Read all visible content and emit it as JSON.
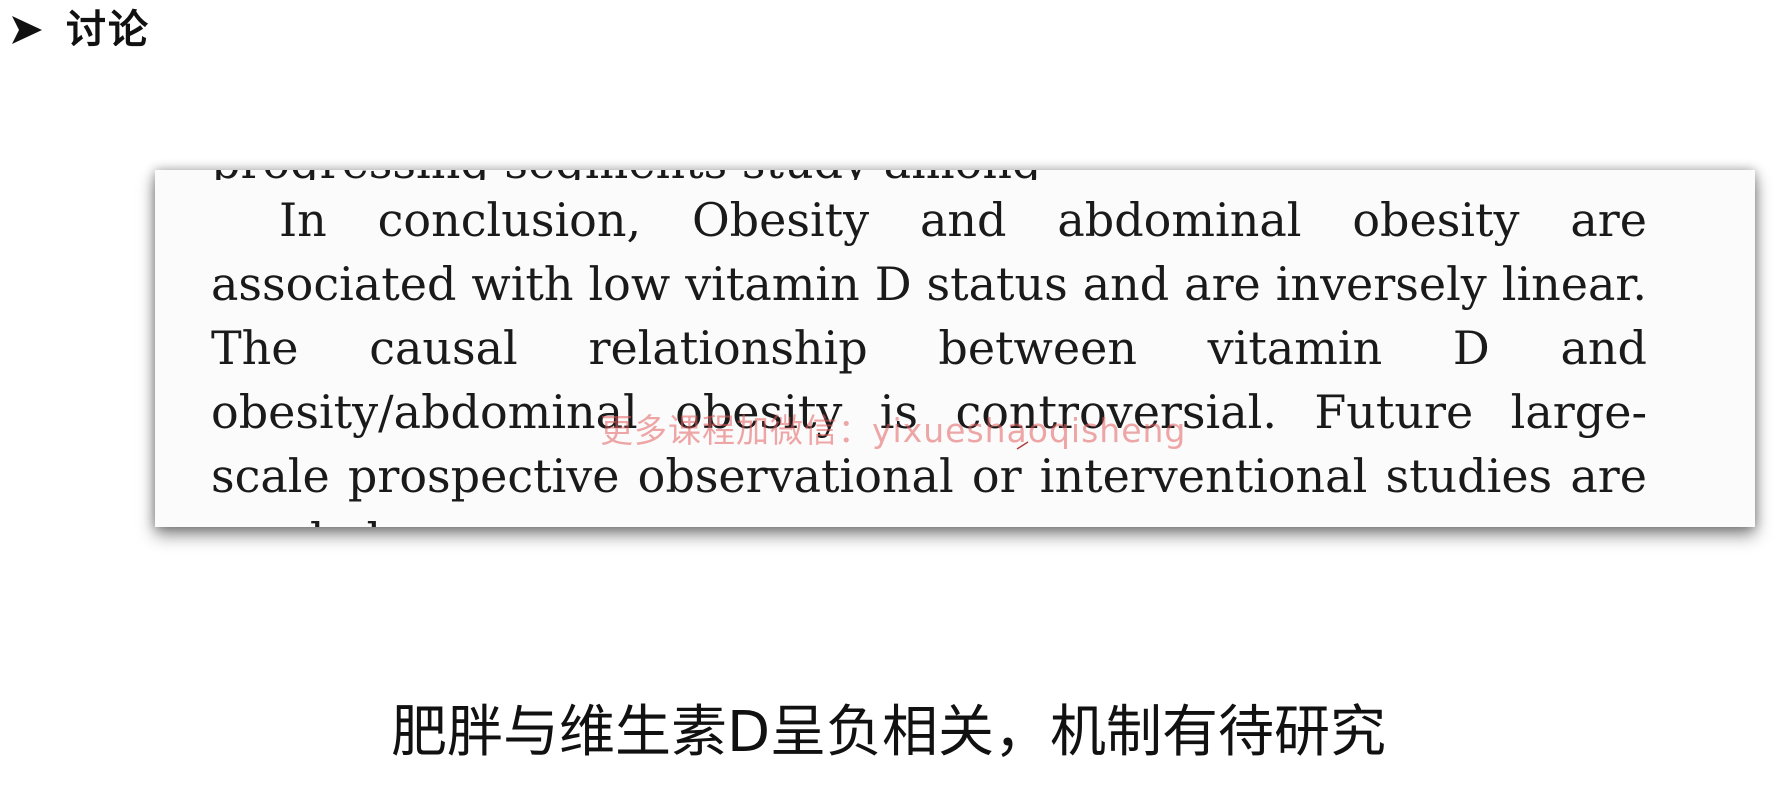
{
  "header": {
    "title": "讨论",
    "bullet_icon": "arrow-bullet-icon"
  },
  "excerpt": {
    "clipped_text": "progressing segments study among",
    "paragraph": "In conclusion, Obesity and abdominal obesity are associated with low vitamin D status and are inversely linear. The causal relationship between vitamin D and obesity/abdominal obesity is controversial. Future large-scale prospective observational or interventional studies are needed."
  },
  "watermark": {
    "text": "更多课程加微信：yixueshaoqisheng"
  },
  "caption": {
    "text": "肥胖与维生素D呈负相关，机制有待研究"
  }
}
